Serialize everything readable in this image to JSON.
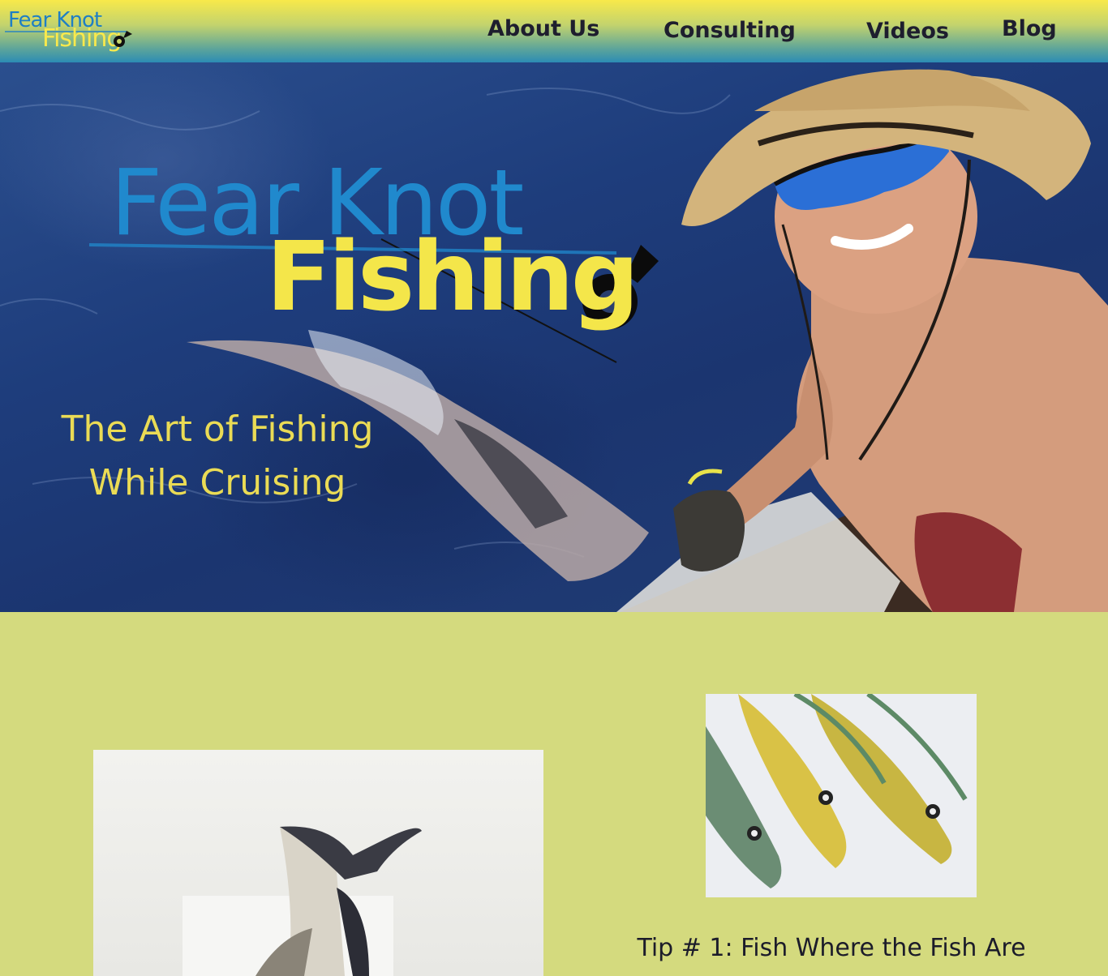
{
  "header": {
    "logo": {
      "line1": "Fear Knot",
      "line2": "Fishing"
    },
    "nav": [
      {
        "label": "About Us"
      },
      {
        "label": "Consulting"
      },
      {
        "label": "Videos"
      },
      {
        "label": "Blog"
      }
    ]
  },
  "hero": {
    "logo": {
      "line1": "Fear Knot",
      "line2": "Fishing"
    },
    "tagline_line1": "The Art of Fishing",
    "tagline_line2": "While Cruising"
  },
  "content": {
    "tip_title": "Tip # 1: Fish Where the Fish Are"
  },
  "colors": {
    "accent_yellow": "#f4e64a",
    "accent_blue": "#2089cd",
    "page_background": "#d4da7e",
    "nav_text": "#1e1e2e"
  },
  "icons": [
    "fish-hook-icon"
  ]
}
